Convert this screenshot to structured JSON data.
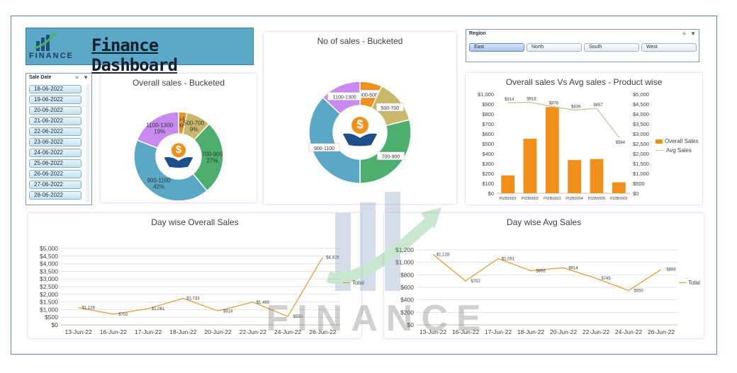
{
  "header": {
    "brand": "FINANCE",
    "title": "Finance Dashboard"
  },
  "icons": {
    "logo": "finance-logo-icon",
    "money_hands": "money-hands-icon",
    "multi_select": "multi-select-icon",
    "clear_filter": "clear-filter-icon"
  },
  "colors": {
    "orange": "#f0901a",
    "tan": "#c9b86a",
    "green": "#4caf6e",
    "blue": "#5ba8c6",
    "violet": "#c98af0",
    "avg_line": "#c8c49a",
    "line_orange": "#e8962a"
  },
  "sale_date_slicer": {
    "title": "Sale Date",
    "items": [
      "18-06-2022",
      "19-06-2022",
      "20-06-2022",
      "21-06-2022",
      "22-06-2022",
      "23-06-2022",
      "24-06-2022",
      "25-06-2022",
      "26-06-2022",
      "27-06-2022",
      "28-06-2022"
    ]
  },
  "region_slicer": {
    "title": "Region",
    "items": [
      "East",
      "North",
      "South",
      "West"
    ],
    "selected": "East"
  },
  "chart_data": [
    {
      "id": "overall-sales-bucketed",
      "type": "pie",
      "subtype": "doughnut",
      "title": "Overall sales - Bucketed",
      "categories": [
        "300-500",
        "500-700",
        "700-900",
        "900-1100",
        "1100-1300"
      ],
      "values": [
        3,
        9,
        27,
        42,
        19
      ],
      "labels": [
        "300-500\n3%",
        "500-700\n9%",
        "700-900\n27%",
        "900-1100\n42%",
        "1100-1300\n19%"
      ],
      "unit": "%"
    },
    {
      "id": "no-of-sales-bucketed",
      "type": "pie",
      "subtype": "doughnut",
      "title": "No of sales - Bucketed",
      "categories": [
        "300-500",
        "500-700",
        "700-900",
        "900-1100",
        "1100-1300"
      ],
      "values": [
        7,
        14,
        29,
        37,
        13
      ],
      "labels": [
        "300-500",
        "500-700",
        "700-900",
        "900-1100",
        "1100-1300"
      ]
    },
    {
      "id": "overall-vs-avg-product",
      "type": "bar",
      "title": "Overall sales Vs Avg sales - Product wise",
      "categories": [
        "PIZB0001",
        "PIZB0002",
        "PIZB0003",
        "PIZB0004",
        "PIZB0005",
        "PIZB0006"
      ],
      "series": [
        {
          "name": "Overall Sales",
          "type": "bar",
          "axis": "left",
          "values": [
            180,
            550,
            870,
            335,
            345,
            110
          ]
        },
        {
          "name": "Avg Sales",
          "type": "line",
          "axis": "right",
          "values": [
            914,
            918,
            876,
            839,
            857,
            564
          ],
          "labels": [
            "$914",
            "$918",
            "$876",
            "$839",
            "$857",
            "$564"
          ]
        }
      ],
      "ylim_left": [
        0,
        1000
      ],
      "yticks_left": [
        "$0",
        "$100",
        "$200",
        "$300",
        "$400",
        "$500",
        "$600",
        "$700",
        "$800",
        "$900",
        "$1,000"
      ],
      "ylim_right": [
        0,
        5000
      ],
      "yticks_right": [
        "$0",
        "$500",
        "$1,000",
        "$1,500",
        "$2,000",
        "$2,500",
        "$3,000",
        "$3,500",
        "$4,000",
        "$4,500",
        "$5,000"
      ],
      "legend": "right"
    },
    {
      "id": "day-wise-overall-sales",
      "type": "line",
      "title": "Day wise Overall Sales",
      "categories": [
        "13-Jun-22",
        "16-Jun-22",
        "17-Jun-22",
        "18-Jun-22",
        "20-Jun-22",
        "22-Jun-22",
        "24-Jun-22",
        "26-Jun-22"
      ],
      "series": [
        {
          "name": "Total",
          "values": [
            1128,
            702,
            1061,
            1733,
            914,
            1489,
            550,
            4428
          ],
          "labels": [
            "$1,128",
            "$702",
            "$1,061",
            "$1,733",
            "$914",
            "$1,489",
            "$550",
            "$4,428"
          ]
        }
      ],
      "ylim": [
        0,
        5000
      ],
      "yticks": [
        "$0",
        "$500",
        "$1,000",
        "$1,500",
        "$2,000",
        "$2,500",
        "$3,000",
        "$3,500",
        "$4,000",
        "$4,500",
        "$5,000"
      ],
      "legend": "right"
    },
    {
      "id": "day-wise-avg-sales",
      "type": "line",
      "title": "Day wise  Avg Sales",
      "categories": [
        "13-Jun-22",
        "16-Jun-22",
        "17-Jun-22",
        "18-Jun-22",
        "20-Jun-22",
        "22-Jun-22",
        "24-Jun-22",
        "26-Jun-22"
      ],
      "series": [
        {
          "name": "Total",
          "values": [
            1128,
            702,
            1061,
            866,
            914,
            745,
            550,
            886
          ],
          "labels": [
            "$1,128",
            "$702",
            "$1,061",
            "$866",
            "$914",
            "$745",
            "$550",
            "$886"
          ]
        }
      ],
      "ylim": [
        0,
        1200
      ],
      "yticks": [
        "$0",
        "$200",
        "$400",
        "$600",
        "$800",
        "$1,000",
        "$1,200"
      ],
      "legend": "right"
    }
  ],
  "watermark": {
    "text": "FINANCE"
  }
}
